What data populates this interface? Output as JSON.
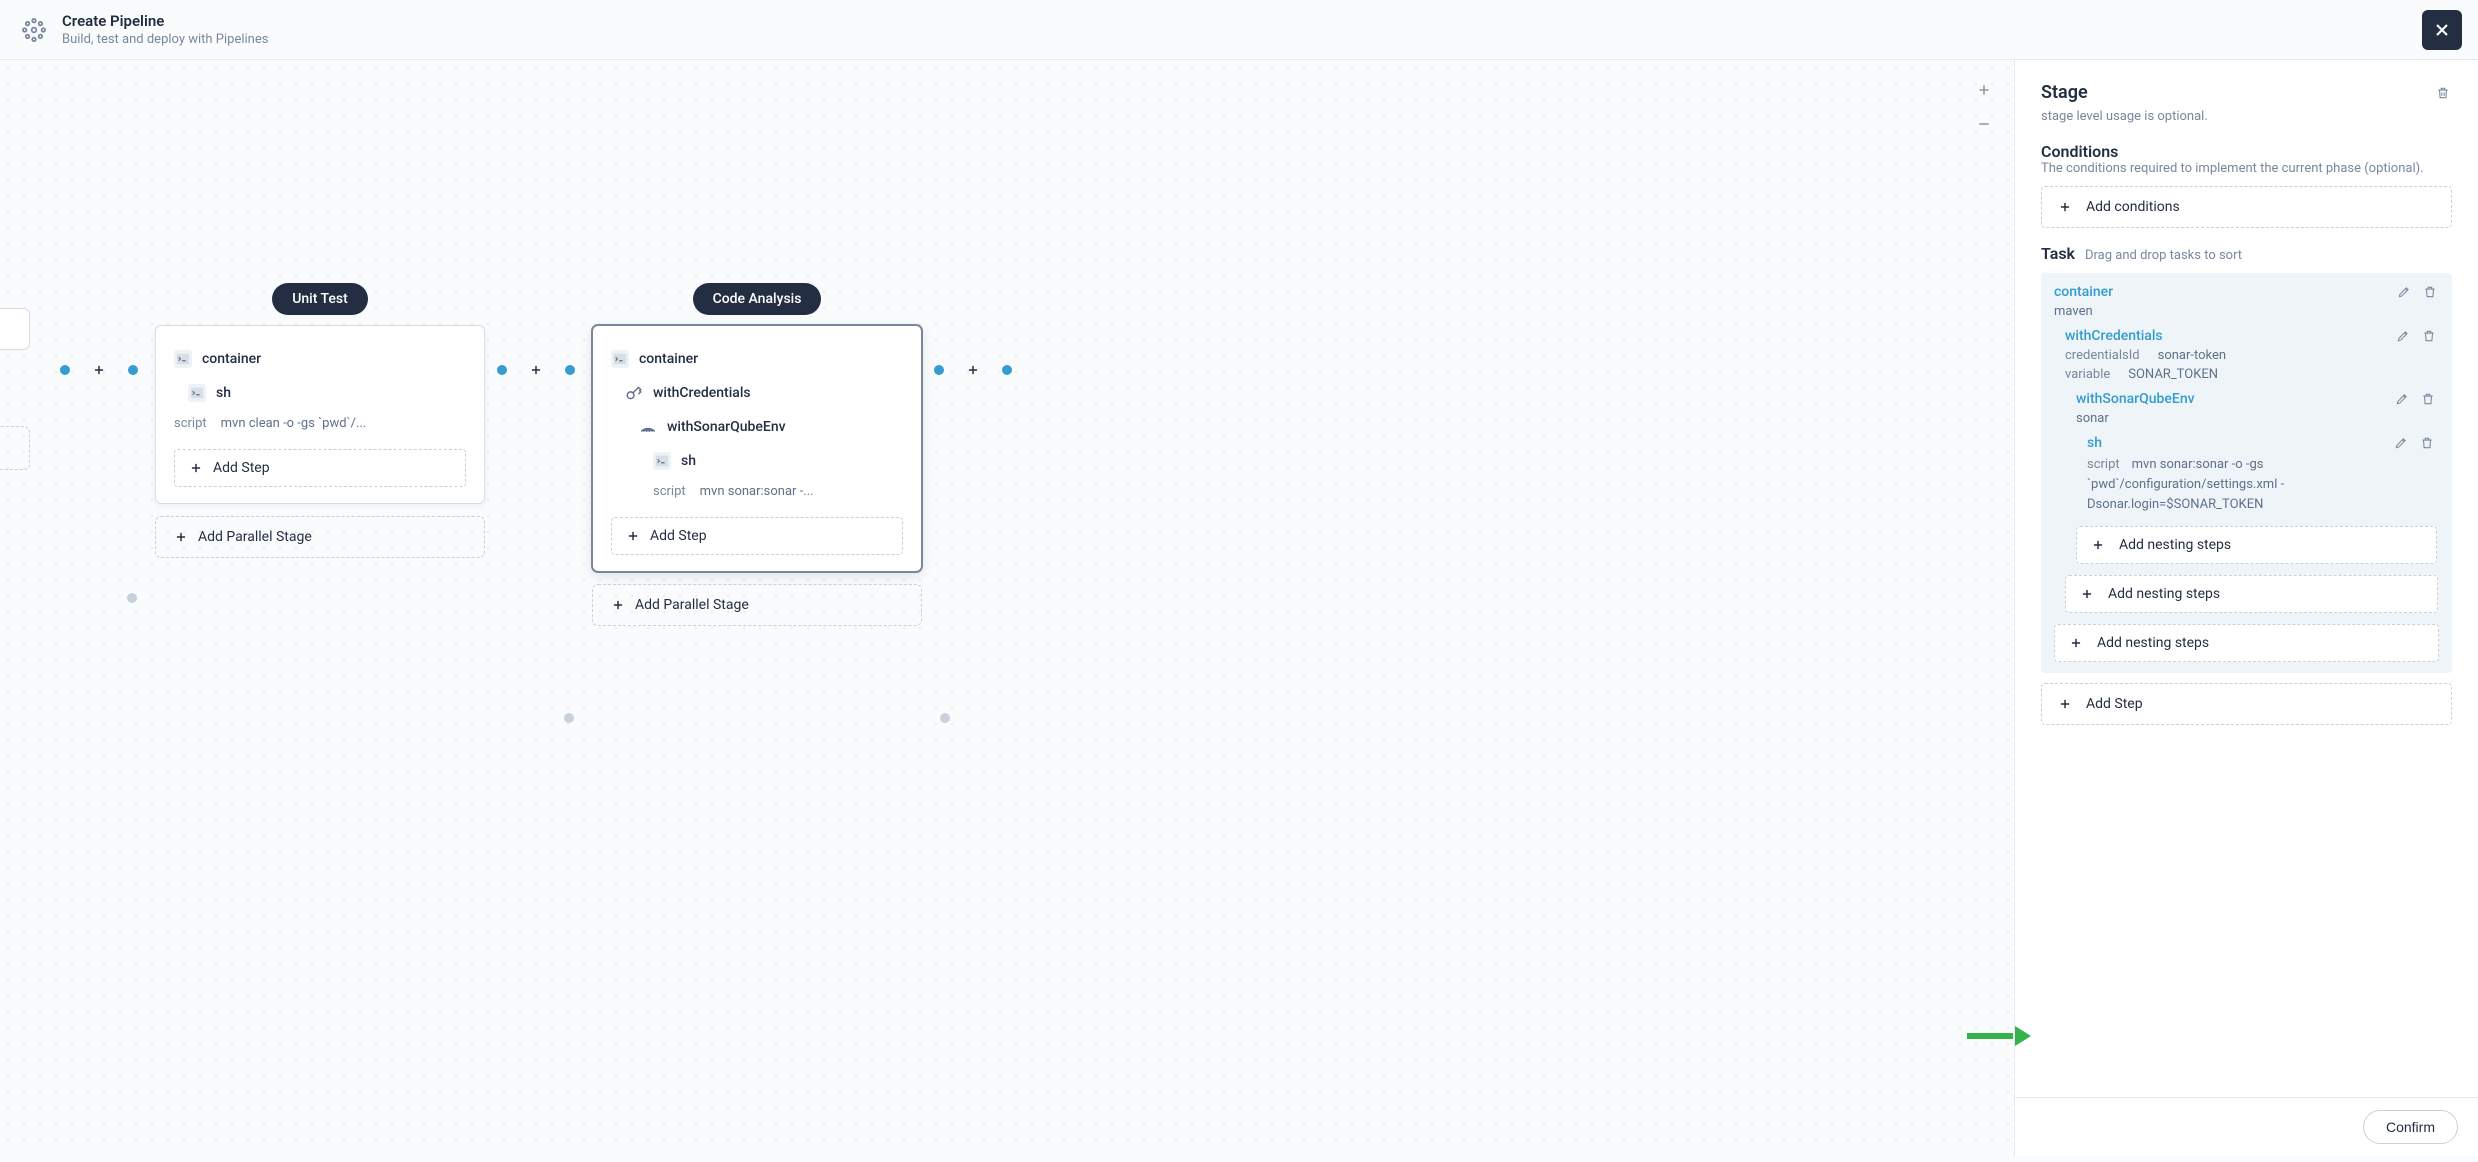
{
  "header": {
    "title": "Create Pipeline",
    "subtitle": "Build, test and deploy with Pipelines"
  },
  "canvas": {
    "stages": [
      {
        "name": "Unit Test",
        "selected": false,
        "steps": [
          {
            "type": "container",
            "label": "container"
          },
          {
            "type": "sh",
            "label": "sh",
            "scriptKey": "script",
            "scriptVal": "mvn clean -o -gs `pwd`/..."
          }
        ],
        "addStep": "Add Step",
        "addParallel": "Add Parallel Stage"
      },
      {
        "name": "Code Analysis",
        "selected": true,
        "steps": [
          {
            "type": "container",
            "label": "container"
          },
          {
            "type": "withCredentials",
            "label": "withCredentials"
          },
          {
            "type": "withSonarQubeEnv",
            "label": "withSonarQubeEnv"
          },
          {
            "type": "sh",
            "label": "sh",
            "scriptKey": "script",
            "scriptVal": "mvn sonar:sonar -..."
          }
        ],
        "addStep": "Add Step",
        "addParallel": "Add Parallel Stage"
      }
    ]
  },
  "panel": {
    "title": "Stage",
    "hint": "stage level usage is optional.",
    "conditions": {
      "title": "Conditions",
      "desc": "The conditions required to implement the current phase (optional).",
      "addBtn": "Add conditions"
    },
    "task": {
      "title": "Task",
      "desc": "Drag and drop tasks to sort"
    },
    "tree": {
      "container": {
        "name": "container",
        "value": "maven",
        "withCredentials": {
          "name": "withCredentials",
          "kv": [
            {
              "k": "credentialsId",
              "v": "sonar-token"
            },
            {
              "k": "variable",
              "v": "SONAR_TOKEN"
            }
          ],
          "withSonarQubeEnv": {
            "name": "withSonarQubeEnv",
            "value": "sonar",
            "sh": {
              "name": "sh",
              "scriptKey": "script",
              "scriptVal": "mvn sonar:sonar -o -gs `pwd`/configuration/settings.xml -Dsonar.login=$SONAR_TOKEN"
            },
            "addNesting": "Add nesting steps"
          },
          "addNesting": "Add nesting steps"
        },
        "addNesting": "Add nesting steps"
      }
    },
    "addStep": "Add Step"
  },
  "footer": {
    "confirm": "Confirm"
  }
}
